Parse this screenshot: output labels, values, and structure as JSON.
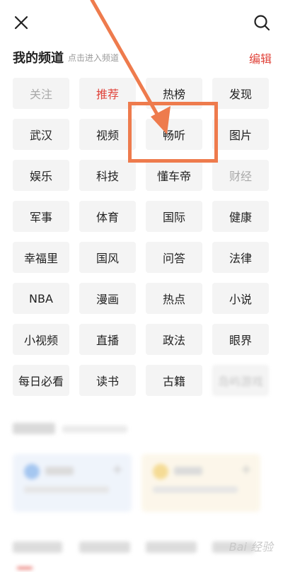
{
  "header": {
    "title": "我的频道",
    "hint": "点击进入频道",
    "edit_label": "编辑"
  },
  "icons": {
    "close": "close-icon",
    "search": "search-icon"
  },
  "colors": {
    "accent": "#e0453c",
    "annotation": "#ee7b4d",
    "chip_bg": "#f4f4f4"
  },
  "channels": [
    {
      "label": "关注",
      "state": "muted"
    },
    {
      "label": "推荐",
      "state": "active"
    },
    {
      "label": "热榜",
      "state": "normal"
    },
    {
      "label": "发现",
      "state": "normal"
    },
    {
      "label": "武汉",
      "state": "normal"
    },
    {
      "label": "视频",
      "state": "normal"
    },
    {
      "label": "畅听",
      "state": "normal"
    },
    {
      "label": "图片",
      "state": "normal"
    },
    {
      "label": "娱乐",
      "state": "normal"
    },
    {
      "label": "科技",
      "state": "normal"
    },
    {
      "label": "懂车帝",
      "state": "normal"
    },
    {
      "label": "财经",
      "state": "muted"
    },
    {
      "label": "军事",
      "state": "normal"
    },
    {
      "label": "体育",
      "state": "normal"
    },
    {
      "label": "国际",
      "state": "normal"
    },
    {
      "label": "健康",
      "state": "normal"
    },
    {
      "label": "幸福里",
      "state": "normal"
    },
    {
      "label": "国风",
      "state": "normal"
    },
    {
      "label": "问答",
      "state": "normal"
    },
    {
      "label": "法律",
      "state": "normal"
    },
    {
      "label": "NBA",
      "state": "normal"
    },
    {
      "label": "漫画",
      "state": "normal"
    },
    {
      "label": "热点",
      "state": "normal"
    },
    {
      "label": "小说",
      "state": "normal"
    },
    {
      "label": "小视频",
      "state": "normal"
    },
    {
      "label": "直播",
      "state": "normal"
    },
    {
      "label": "政法",
      "state": "normal"
    },
    {
      "label": "眼界",
      "state": "normal"
    },
    {
      "label": "每日必看",
      "state": "normal"
    },
    {
      "label": "读书",
      "state": "normal"
    },
    {
      "label": "古籍",
      "state": "normal"
    },
    {
      "label": "岛屿游戏",
      "state": "blurred"
    }
  ],
  "watermark": "Bai 经验"
}
